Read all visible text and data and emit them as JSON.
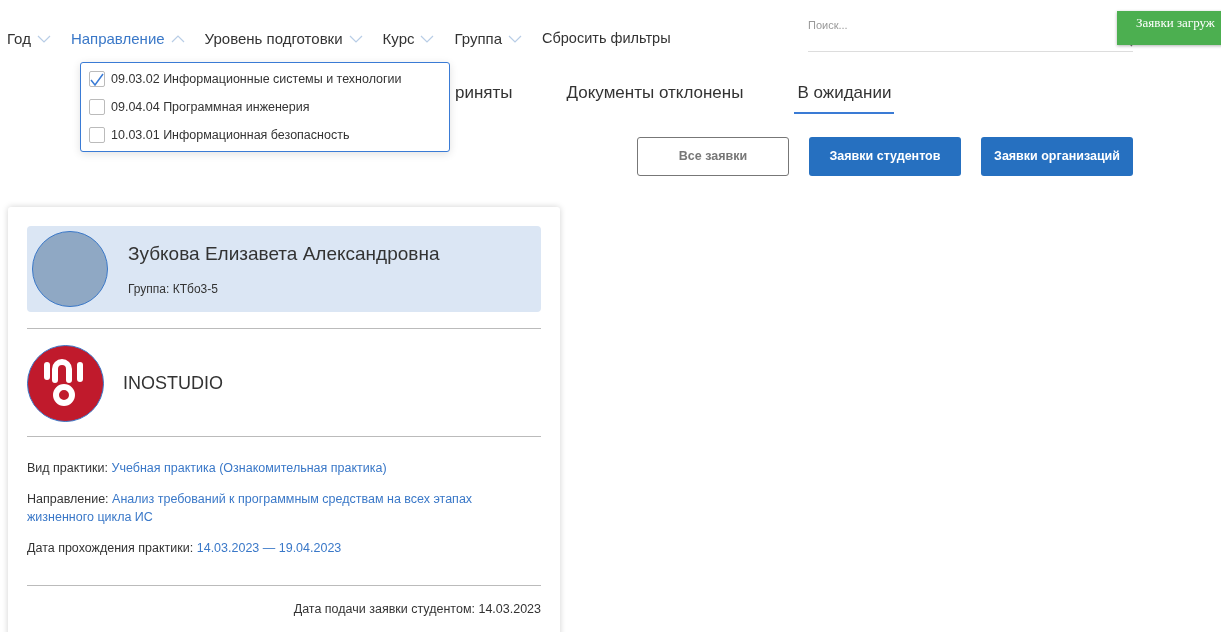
{
  "filters": [
    {
      "label": "Год",
      "expanded": false
    },
    {
      "label": "Направление",
      "expanded": true
    },
    {
      "label": "Уровень подготовки",
      "expanded": false
    },
    {
      "label": "Курс",
      "expanded": false
    },
    {
      "label": "Группа",
      "expanded": false
    }
  ],
  "reset_filters": "Сбросить фильтры",
  "direction_dropdown": {
    "options": [
      {
        "label": "09.03.02 Информационные системы и технологии",
        "checked": true
      },
      {
        "label": "09.04.04 Программная инженерия",
        "checked": false
      },
      {
        "label": "10.03.01 Информационная безопасность",
        "checked": false
      }
    ]
  },
  "search": {
    "placeholder": "Поиск..."
  },
  "toast": "Заявки загруж",
  "tabs": [
    {
      "label": "риняты",
      "selected": false
    },
    {
      "label": "Документы отклонены",
      "selected": false
    },
    {
      "label": "В ожидании",
      "selected": true
    }
  ],
  "type_buttons": [
    {
      "label": "Все заявки",
      "selected": false
    },
    {
      "label": "Заявки студентов",
      "selected": true
    },
    {
      "label": "Заявки организаций",
      "selected": true
    }
  ],
  "card": {
    "student_name": "Зубкова Елизавета Александровна",
    "group": "Группа: КТбо3-5",
    "organization": "INOSTUDIO",
    "details": [
      {
        "label": "Вид практики:",
        "value": "Учебная практика (Ознакомительная практика)"
      },
      {
        "label": "Направление:",
        "value": "Анализ требований к программным средствам на всех этапах жизненного цикла ИС"
      },
      {
        "label": "Дата прохождения практики:",
        "value": "14.03.2023 — 19.04.2023"
      }
    ],
    "submitted": "Дата подачи заявки студентом: 14.03.2023"
  }
}
